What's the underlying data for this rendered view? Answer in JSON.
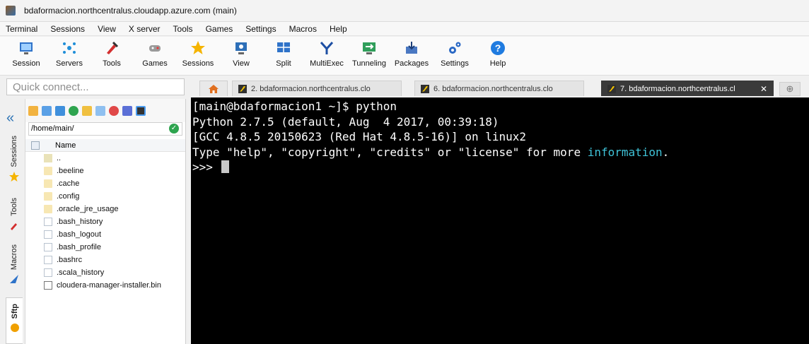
{
  "window": {
    "title": "bdaformacion.northcentralus.cloudapp.azure.com (main)"
  },
  "menu": [
    "Terminal",
    "Sessions",
    "View",
    "X server",
    "Tools",
    "Games",
    "Settings",
    "Macros",
    "Help"
  ],
  "toolbar": [
    {
      "label": "Session",
      "icon": "session-icon"
    },
    {
      "label": "Servers",
      "icon": "servers-icon"
    },
    {
      "label": "Tools",
      "icon": "tools-icon"
    },
    {
      "label": "Games",
      "icon": "games-icon"
    },
    {
      "label": "Sessions",
      "icon": "star-icon"
    },
    {
      "label": "View",
      "icon": "view-icon"
    },
    {
      "label": "Split",
      "icon": "split-icon"
    },
    {
      "label": "MultiExec",
      "icon": "multiexec-icon"
    },
    {
      "label": "Tunneling",
      "icon": "tunneling-icon"
    },
    {
      "label": "Packages",
      "icon": "packages-icon"
    },
    {
      "label": "Settings",
      "icon": "settings-icon"
    },
    {
      "label": "Help",
      "icon": "help-icon"
    }
  ],
  "quick_connect": {
    "placeholder": "Quick connect..."
  },
  "tabs": [
    {
      "label": "2. bdaformacion.northcentralus.clo"
    },
    {
      "label": "6. bdaformacion.northcentralus.clo"
    },
    {
      "label": "7. bdaformacion.northcentralus.cl",
      "active": true
    }
  ],
  "sidebar": {
    "vtabs": [
      "Sessions",
      "Tools",
      "Macros",
      "Sftp"
    ],
    "path": "/home/main/",
    "column": "Name",
    "files": [
      {
        "name": "..",
        "type": "updir"
      },
      {
        "name": ".beeline",
        "type": "folder"
      },
      {
        "name": ".cache",
        "type": "folder"
      },
      {
        "name": ".config",
        "type": "folder"
      },
      {
        "name": ".oracle_jre_usage",
        "type": "folder"
      },
      {
        "name": ".bash_history",
        "type": "file"
      },
      {
        "name": ".bash_logout",
        "type": "file"
      },
      {
        "name": ".bash_profile",
        "type": "file"
      },
      {
        "name": ".bashrc",
        "type": "file"
      },
      {
        "name": ".scala_history",
        "type": "file"
      },
      {
        "name": "cloudera-manager-installer.bin",
        "type": "bin"
      }
    ]
  },
  "terminal": {
    "lines": [
      "[main@bdaformacion1 ~]$ python",
      "Python 2.7.5 (default, Aug  4 2017, 00:39:18)",
      "[GCC 4.8.5 20150623 (Red Hat 4.8.5-16)] on linux2"
    ],
    "help_line_prefix": "Type \"help\", \"copyright\", \"credits\" or \"license\" for more ",
    "help_line_link": "information",
    "help_line_suffix": ".",
    "prompt": ">>> ",
    "colors": {
      "background": "#000000",
      "text": "#ffffff",
      "link": "#3fc3d8"
    }
  }
}
